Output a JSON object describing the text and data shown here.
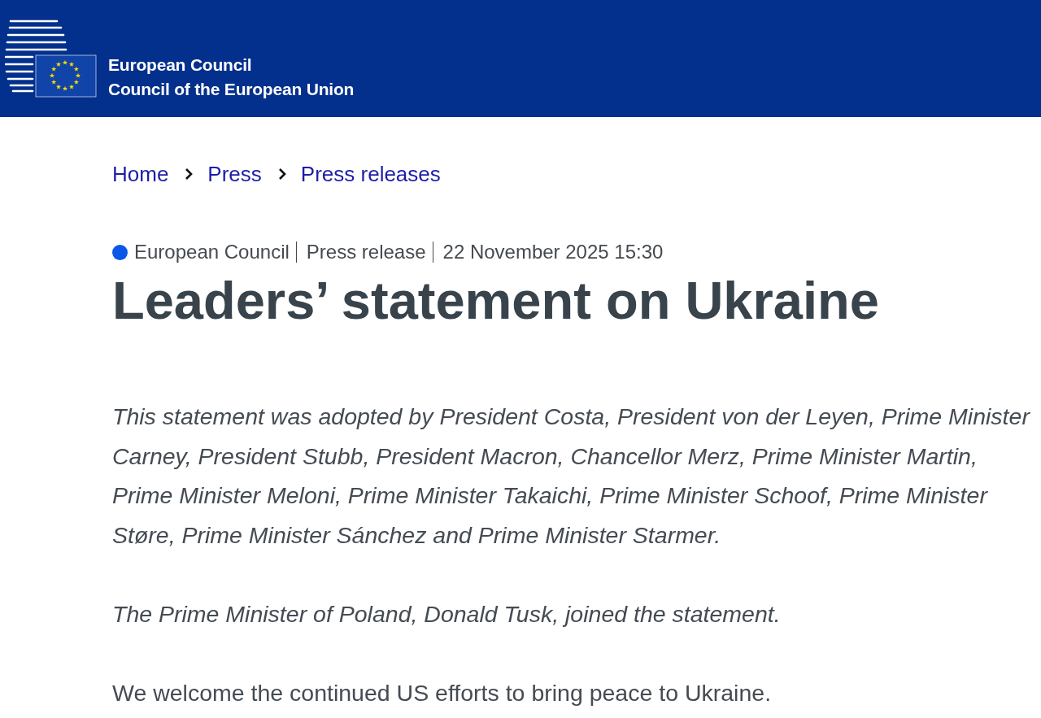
{
  "header": {
    "names": [
      "European Council",
      "Council of the European Union"
    ]
  },
  "breadcrumb": [
    {
      "label": "Home"
    },
    {
      "label": "Press"
    },
    {
      "label": "Press releases"
    }
  ],
  "meta": {
    "items": [
      "European Council",
      "Press release",
      "22 November 2025 15:30"
    ]
  },
  "title": "Leaders’ statement on Ukraine",
  "paragraphs": [
    {
      "kind": "lead",
      "text": "This statement was adopted by President Costa, President von der Leyen, Prime Minister Carney, President Stubb, President Macron, Chancellor Merz, Prime Minister Martin, Prime Minister Meloni, Prime Minister Takaichi, Prime Minister Schoof, Prime Minister Støre, Prime Minister Sánchez and Prime Minister Starmer."
    },
    {
      "kind": "lead",
      "text": "The Prime Minister of Poland, Donald Tusk, joined the statement."
    },
    {
      "kind": "body",
      "text": "We welcome the continued US efforts to bring peace to Ukraine."
    }
  ]
}
